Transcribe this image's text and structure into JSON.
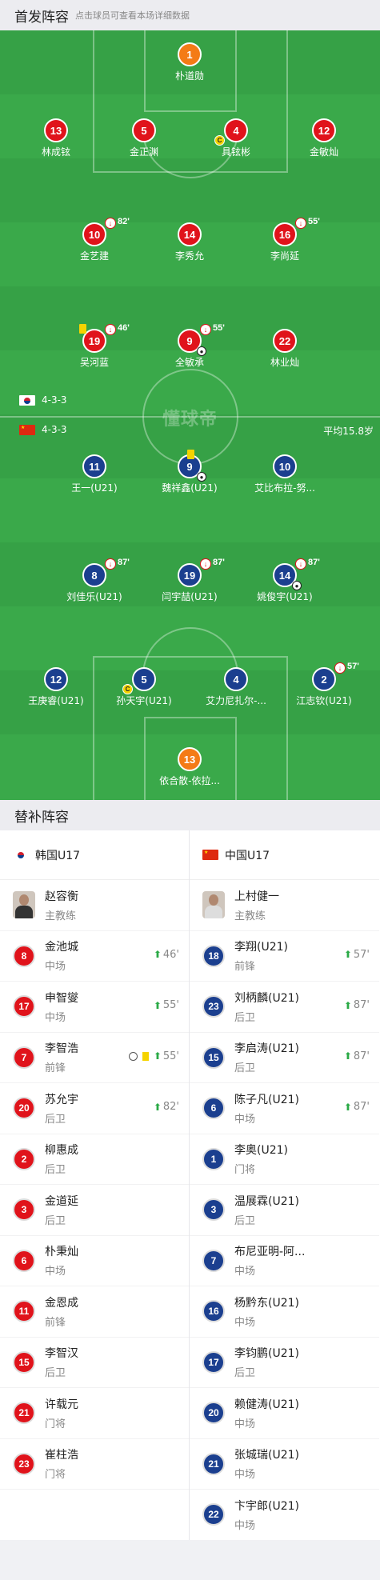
{
  "header": {
    "title": "首发阵容",
    "hint": "点击球员可查看本场详细数据"
  },
  "pitch": {
    "watermark": "懂球帝",
    "home": {
      "flag": "韩国",
      "formation": "4-3-3"
    },
    "away": {
      "flag": "中国",
      "formation": "4-3-3",
      "avg_age": "平均15.8岁"
    },
    "players": [
      {
        "num": "1",
        "name": "朴道勋",
        "team": "orange"
      },
      {
        "num": "13",
        "name": "林成铉",
        "team": "red"
      },
      {
        "num": "5",
        "name": "金正渊",
        "team": "red"
      },
      {
        "num": "4",
        "name": "具铉彬",
        "team": "red",
        "captain": "C"
      },
      {
        "num": "12",
        "name": "金敏灿",
        "team": "red"
      },
      {
        "num": "10",
        "name": "金艺建",
        "team": "red",
        "sub_min": "82'"
      },
      {
        "num": "14",
        "name": "李秀允",
        "team": "red"
      },
      {
        "num": "16",
        "name": "李尚延",
        "team": "red",
        "sub_min": "55'"
      },
      {
        "num": "19",
        "name": "吴河蓝",
        "team": "red",
        "sub_min": "46'",
        "yellow": true
      },
      {
        "num": "9",
        "name": "全敏承",
        "team": "red",
        "sub_min": "55'",
        "goal": true
      },
      {
        "num": "22",
        "name": "林业灿",
        "team": "red"
      },
      {
        "num": "11",
        "name": "王一(U21)",
        "team": "blue"
      },
      {
        "num": "9",
        "name": "魏祥鑫(U21)",
        "team": "blue",
        "yellow": true,
        "goal": true
      },
      {
        "num": "10",
        "name": "艾比布拉-努...",
        "team": "blue"
      },
      {
        "num": "8",
        "name": "刘佳乐(U21)",
        "team": "blue",
        "sub_min": "87'"
      },
      {
        "num": "19",
        "name": "闫宇喆(U21)",
        "team": "blue",
        "sub_min": "87'"
      },
      {
        "num": "14",
        "name": "姚俊宇(U21)",
        "team": "blue",
        "sub_min": "87'",
        "goal": true
      },
      {
        "num": "12",
        "name": "王庚睿(U21)",
        "team": "blue"
      },
      {
        "num": "5",
        "name": "孙天宇(U21)",
        "team": "blue",
        "captain": "C"
      },
      {
        "num": "4",
        "name": "艾力尼扎尔-...",
        "team": "blue"
      },
      {
        "num": "2",
        "name": "江志钦(U21)",
        "team": "blue",
        "sub_min": "57'"
      },
      {
        "num": "13",
        "name": "依合散-依拉...",
        "team": "orange"
      }
    ]
  },
  "subs": {
    "title": "替补阵容",
    "home": {
      "team": "韩国U17",
      "coach": {
        "name": "赵容衡",
        "role": "主教练"
      },
      "players": [
        {
          "num": "8",
          "name": "金池城",
          "pos": "中场",
          "in": "46'"
        },
        {
          "num": "17",
          "name": "申智燮",
          "pos": "中场",
          "in": "55'"
        },
        {
          "num": "7",
          "name": "李智浩",
          "pos": "前锋",
          "in": "55'",
          "goal": true,
          "yellow": true
        },
        {
          "num": "20",
          "name": "苏允宇",
          "pos": "后卫",
          "in": "82'"
        },
        {
          "num": "2",
          "name": "柳惠成",
          "pos": "后卫"
        },
        {
          "num": "3",
          "name": "金道延",
          "pos": "后卫"
        },
        {
          "num": "6",
          "name": "朴秉灿",
          "pos": "中场"
        },
        {
          "num": "11",
          "name": "金恩成",
          "pos": "前锋"
        },
        {
          "num": "15",
          "name": "李智汉",
          "pos": "后卫"
        },
        {
          "num": "21",
          "name": "许载元",
          "pos": "门将"
        },
        {
          "num": "23",
          "name": "崔柱浩",
          "pos": "门将"
        }
      ]
    },
    "away": {
      "team": "中国U17",
      "coach": {
        "name": "上村健一",
        "role": "主教练"
      },
      "players": [
        {
          "num": "18",
          "name": "李翔(U21)",
          "pos": "前锋",
          "in": "57'"
        },
        {
          "num": "23",
          "name": "刘柄麟(U21)",
          "pos": "后卫",
          "in": "87'"
        },
        {
          "num": "15",
          "name": "李启涛(U21)",
          "pos": "后卫",
          "in": "87'"
        },
        {
          "num": "6",
          "name": "陈子凡(U21)",
          "pos": "中场",
          "in": "87'"
        },
        {
          "num": "1",
          "name": "李奥(U21)",
          "pos": "门将"
        },
        {
          "num": "3",
          "name": "温展霖(U21)",
          "pos": "后卫"
        },
        {
          "num": "7",
          "name": "布尼亚明-阿...",
          "pos": "中场"
        },
        {
          "num": "16",
          "name": "杨黔东(U21)",
          "pos": "中场"
        },
        {
          "num": "17",
          "name": "李钧鹏(U21)",
          "pos": "后卫"
        },
        {
          "num": "20",
          "name": "赖健涛(U21)",
          "pos": "中场"
        },
        {
          "num": "21",
          "name": "张城瑞(U21)",
          "pos": "中场"
        },
        {
          "num": "22",
          "name": "卞宇郎(U21)",
          "pos": "中场"
        }
      ]
    }
  },
  "colors": {
    "home": "#e0131b",
    "away": "#1b3f8f",
    "gk": "#f47b16",
    "pitch": "#3aa94a"
  }
}
